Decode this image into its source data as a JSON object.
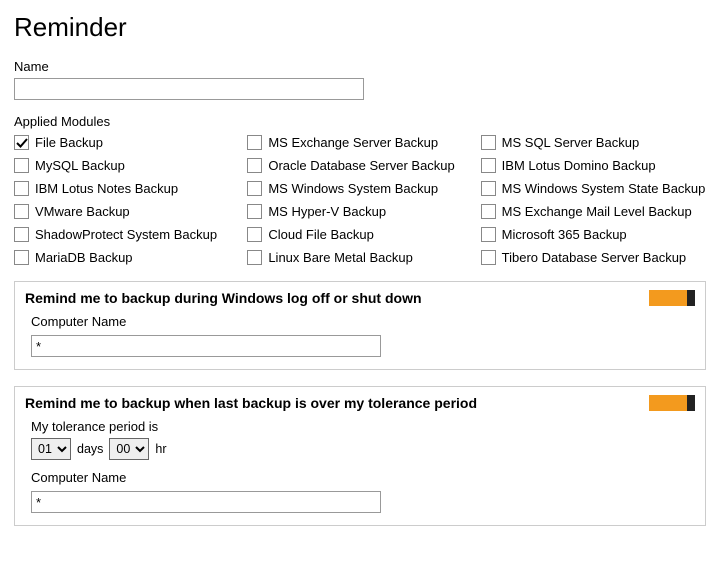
{
  "title": "Reminder",
  "name_label": "Name",
  "name_value": "",
  "applied_modules_label": "Applied Modules",
  "modules": {
    "col1": [
      {
        "id": "file-backup",
        "label": "File Backup",
        "checked": true
      },
      {
        "id": "mysql-backup",
        "label": "MySQL Backup",
        "checked": false
      },
      {
        "id": "lotus-notes-backup",
        "label": "IBM Lotus Notes Backup",
        "checked": false
      },
      {
        "id": "vmware-backup",
        "label": "VMware Backup",
        "checked": false
      },
      {
        "id": "shadowprotect-backup",
        "label": "ShadowProtect System Backup",
        "checked": false
      },
      {
        "id": "mariadb-backup",
        "label": "MariaDB Backup",
        "checked": false
      }
    ],
    "col2": [
      {
        "id": "exchange-server-backup",
        "label": "MS Exchange Server Backup",
        "checked": false
      },
      {
        "id": "oracle-db-backup",
        "label": "Oracle Database Server Backup",
        "checked": false
      },
      {
        "id": "win-system-backup",
        "label": "MS Windows System Backup",
        "checked": false
      },
      {
        "id": "hyperv-backup",
        "label": "MS Hyper-V Backup",
        "checked": false
      },
      {
        "id": "cloud-file-backup",
        "label": "Cloud File Backup",
        "checked": false
      },
      {
        "id": "linux-bare-metal",
        "label": "Linux Bare Metal Backup",
        "checked": false
      }
    ],
    "col3": [
      {
        "id": "sql-server-backup",
        "label": "MS SQL Server Backup",
        "checked": false
      },
      {
        "id": "lotus-domino-backup",
        "label": "IBM Lotus Domino Backup",
        "checked": false
      },
      {
        "id": "win-system-state",
        "label": "MS Windows System State Backup",
        "checked": false
      },
      {
        "id": "exchange-mail-level",
        "label": "MS Exchange Mail Level Backup",
        "checked": false
      },
      {
        "id": "m365-backup",
        "label": "Microsoft 365 Backup",
        "checked": false
      },
      {
        "id": "tibero-db-backup",
        "label": "Tibero Database Server Backup",
        "checked": false
      }
    ]
  },
  "panel_logoff": {
    "title": "Remind me to backup during Windows log off or shut down",
    "toggle_on": true,
    "computer_name_label": "Computer Name",
    "computer_name_value": "*"
  },
  "panel_tolerance": {
    "title": "Remind me to backup when last backup is over my tolerance period",
    "toggle_on": true,
    "tolerance_label": "My tolerance period is",
    "days_value": "01",
    "days_unit": "days",
    "hours_value": "00",
    "hours_unit": "hr",
    "computer_name_label": "Computer Name",
    "computer_name_value": "*"
  }
}
